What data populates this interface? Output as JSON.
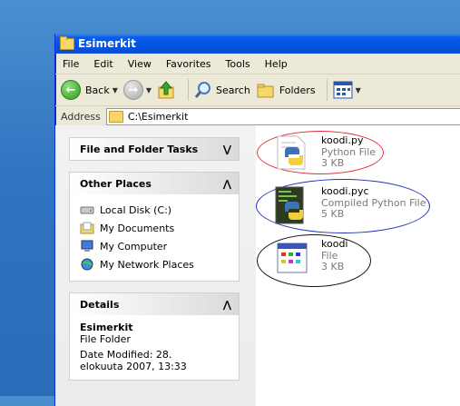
{
  "window": {
    "title": "Esimerkit"
  },
  "menu": [
    "File",
    "Edit",
    "View",
    "Favorites",
    "Tools",
    "Help"
  ],
  "toolbar": {
    "back": "Back",
    "search": "Search",
    "folders": "Folders"
  },
  "address": {
    "label": "Address",
    "value": "C:\\Esimerkit"
  },
  "tasks": {
    "title": "File and Folder Tasks"
  },
  "other_places": {
    "title": "Other Places",
    "items": [
      {
        "label": "Local Disk (C:)",
        "icon": "local-disk-icon"
      },
      {
        "label": "My Documents",
        "icon": "my-documents-icon"
      },
      {
        "label": "My Computer",
        "icon": "my-computer-icon"
      },
      {
        "label": "My Network Places",
        "icon": "network-places-icon"
      }
    ]
  },
  "details": {
    "title": "Details",
    "name": "Esimerkit",
    "type": "File Folder",
    "modified": "Date Modified: 28. elokuuta 2007, 13:33"
  },
  "files": [
    {
      "name": "koodi.py",
      "type": "Python File",
      "size": "3 KB",
      "icon": "python-file-icon",
      "ring_color": "#e0303a"
    },
    {
      "name": "koodi.pyc",
      "type": "Compiled Python File",
      "size": "5 KB",
      "icon": "compiled-python-file-icon",
      "ring_color": "#2233b8"
    },
    {
      "name": "koodi",
      "type": "File",
      "size": "3 KB",
      "icon": "generic-file-icon",
      "ring_color": "#111111"
    }
  ],
  "colors": {
    "titlebar": "#0a5ee6",
    "accent": "#316ac5"
  }
}
